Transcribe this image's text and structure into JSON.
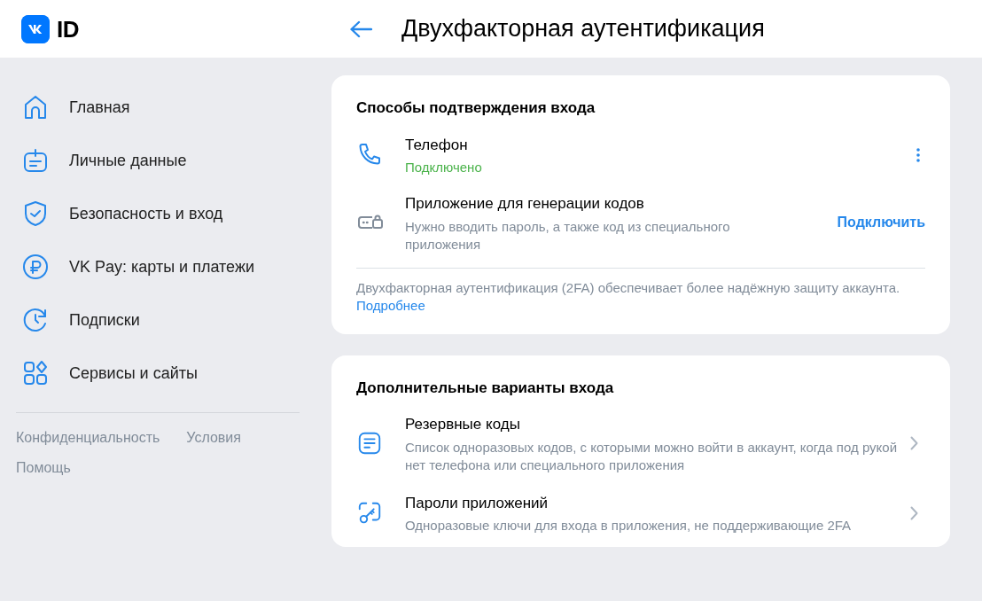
{
  "logo": {
    "text": "ID"
  },
  "header": {
    "title": "Двухфакторная аутентификация"
  },
  "sidebar": {
    "items": [
      {
        "label": "Главная",
        "selected": false
      },
      {
        "label": "Личные данные",
        "selected": false
      },
      {
        "label": "Безопасность и вход",
        "selected": false
      },
      {
        "label": "VK Pay: карты и платежи",
        "selected": false
      },
      {
        "label": "Подписки",
        "selected": false
      },
      {
        "label": "Сервисы и сайты",
        "selected": false
      }
    ],
    "footer_links": [
      "Конфиденциальность",
      "Условия",
      "Помощь"
    ]
  },
  "login_methods": {
    "title": "Способы подтверждения входа",
    "items": [
      {
        "kind": "connected",
        "title": "Телефон",
        "subtitle": "Подключено"
      },
      {
        "kind": "available",
        "title": "Приложение для генерации кодов",
        "subtitle": "Нужно вводить пароль, а также код из специального приложения",
        "action": "Подключить"
      }
    ],
    "note": "Двухфакторная аутентификация (2FA) обеспечивает более надёжную защиту аккаунта.",
    "note_link": "Подробнее"
  },
  "extra_options": {
    "title": "Дополнительные варианты входа",
    "items": [
      {
        "title": "Резервные коды",
        "subtitle": "Список одноразовых кодов, с которыми можно войти в аккаунт, когда под рукой нет телефона или специального приложения"
      },
      {
        "title": "Пароли приложений",
        "subtitle": "Одноразовые ключи для входа в приложения, не поддерживающие 2FA"
      }
    ]
  }
}
